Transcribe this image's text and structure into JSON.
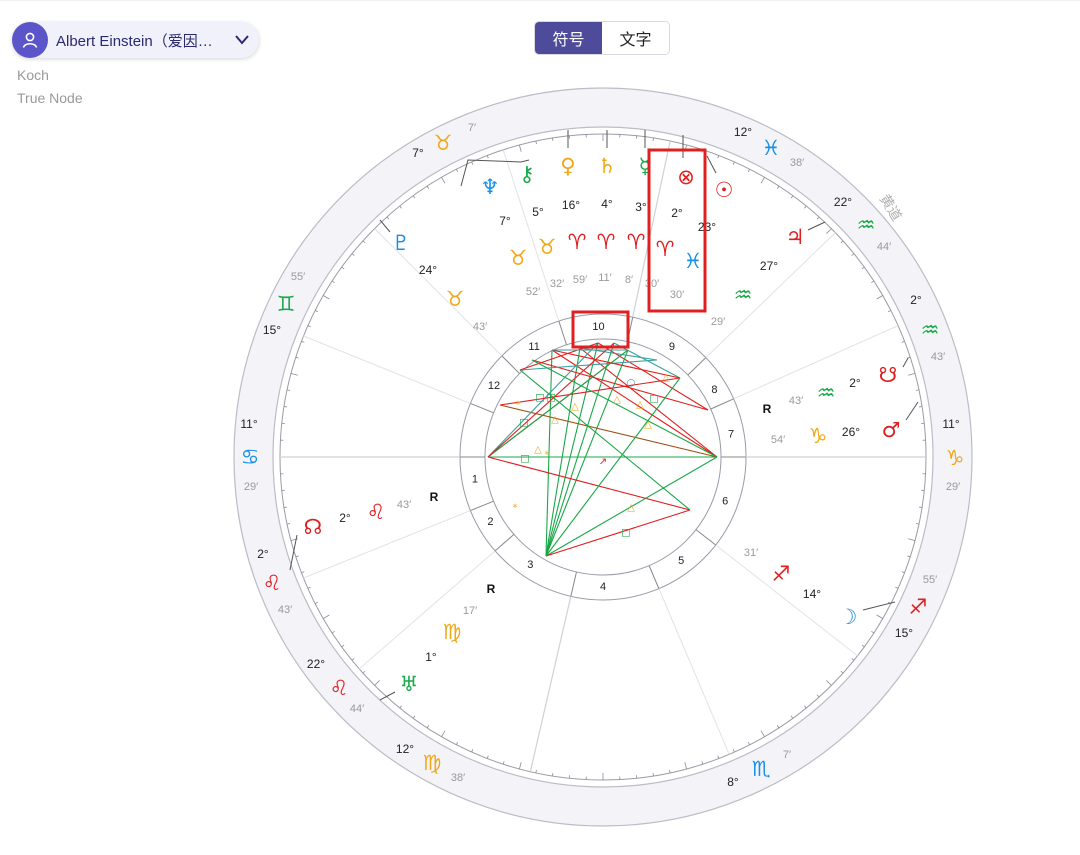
{
  "person": {
    "name": "Albert Einstein（爱因…"
  },
  "meta": {
    "house_system": "Koch",
    "node_type": "True Node"
  },
  "display_toggle": {
    "symbol_label": "符号",
    "text_label": "文字",
    "selected": "符号"
  },
  "wheel": {
    "ecliptic_label": "黄道",
    "colors": {
      "fire": "#e02020",
      "earth": "#f0a818",
      "air": "#18a848",
      "water": "#1890e8",
      "highlight": "#e02020"
    },
    "sign_cusps": [
      {
        "deg": "7°",
        "sign": "♉",
        "element": "earth",
        "min": ""
      },
      {
        "deg": "8°",
        "sign": "♉",
        "element": "earth",
        "min": ""
      },
      {
        "deg": "12°",
        "sign": "♓",
        "element": "water",
        "min": "38′"
      },
      {
        "deg": "22°",
        "sign": "♒",
        "element": "air",
        "min": "44′"
      },
      {
        "deg": "2°",
        "sign": "♒",
        "element": "air",
        "min": "43′"
      },
      {
        "deg": "11°",
        "sign": "♑",
        "element": "earth",
        "min": "29′"
      },
      {
        "deg": "15°",
        "sign": "♐",
        "element": "fire",
        "min": "55′"
      },
      {
        "deg": "8°",
        "sign": "♏",
        "element": "water",
        "min": "7′"
      },
      {
        "deg": "12°",
        "sign": "♍",
        "element": "earth",
        "min": "38′"
      },
      {
        "deg": "22°",
        "sign": "♌",
        "element": "fire",
        "min": "44′"
      },
      {
        "deg": "2°",
        "sign": "♌",
        "element": "fire",
        "min": "43′"
      },
      {
        "deg": "11°",
        "sign": "♋",
        "element": "water",
        "min": "29′"
      },
      {
        "deg": "15°",
        "sign": "♊",
        "element": "air",
        "min": "55′"
      }
    ],
    "planets": [
      {
        "name": "neptune",
        "glyph": "♆",
        "element": "water",
        "deg": "7°",
        "sign": "♉",
        "sign_element": "earth",
        "min": "52′",
        "retro": ""
      },
      {
        "name": "chiron",
        "glyph": "⚷",
        "element": "air",
        "deg": "5°",
        "sign": "♉",
        "sign_element": "earth",
        "min": "32′",
        "retro": ""
      },
      {
        "name": "venus",
        "glyph": "♀",
        "element": "earth",
        "deg": "16°",
        "sign": "♈",
        "sign_element": "fire",
        "min": "59′",
        "retro": ""
      },
      {
        "name": "saturn",
        "glyph": "♄",
        "element": "earth",
        "deg": "4°",
        "sign": "♈",
        "sign_element": "fire",
        "min": "11′",
        "retro": ""
      },
      {
        "name": "mercury",
        "glyph": "☿",
        "element": "air",
        "deg": "3°",
        "sign": "♈",
        "sign_element": "fire",
        "min": "8′",
        "retro": ""
      },
      {
        "name": "part-of-fortune",
        "glyph": "⊗",
        "element": "fire",
        "deg": "2°",
        "sign": "♈",
        "sign_element": "fire",
        "min": "30′",
        "retro": ""
      },
      {
        "name": "sun",
        "glyph": "☉",
        "element": "fire",
        "deg": "23°",
        "sign": "♓",
        "sign_element": "water",
        "min": "30′",
        "retro": ""
      },
      {
        "name": "jupiter",
        "glyph": "♃",
        "element": "fire",
        "deg": "27°",
        "sign": "♒",
        "sign_element": "air",
        "min": "29′",
        "retro": ""
      },
      {
        "name": "south-node",
        "glyph": "☋",
        "element": "fire",
        "deg": "2°",
        "sign": "♒",
        "sign_element": "air",
        "min": "43′",
        "retro": "R"
      },
      {
        "name": "mars",
        "glyph": "♂",
        "element": "fire",
        "deg": "26°",
        "sign": "♑",
        "sign_element": "earth",
        "min": "54′",
        "retro": ""
      },
      {
        "name": "moon",
        "glyph": "☽",
        "element": "water",
        "deg": "14°",
        "sign": "♐",
        "sign_element": "fire",
        "min": "31′",
        "retro": ""
      },
      {
        "name": "uranus",
        "glyph": "♅",
        "element": "air",
        "deg": "1°",
        "sign": "♍",
        "sign_element": "earth",
        "min": "17′",
        "retro": "R"
      },
      {
        "name": "north-node",
        "glyph": "☊",
        "element": "fire",
        "deg": "2°",
        "sign": "♌",
        "sign_element": "fire",
        "min": "43′",
        "retro": "R"
      },
      {
        "name": "pluto",
        "glyph": "♇",
        "element": "water",
        "deg": "24°",
        "sign": "♉",
        "sign_element": "earth",
        "min": "43′",
        "retro": ""
      }
    ],
    "houses": [
      "1",
      "2",
      "3",
      "4",
      "5",
      "6",
      "7",
      "8",
      "9",
      "10",
      "11",
      "12"
    ]
  }
}
